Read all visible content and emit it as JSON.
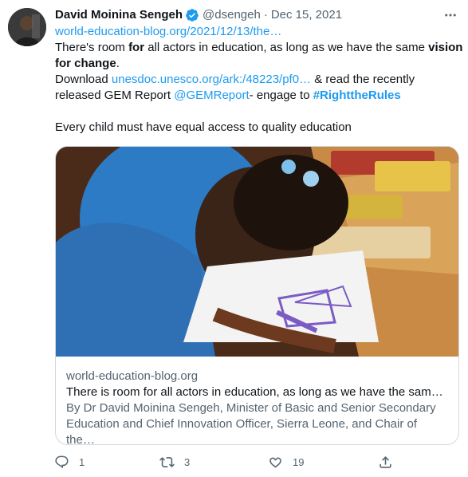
{
  "tweet": {
    "author_name": "David Moinina Sengeh",
    "handle": "@dsengeh",
    "separator": "·",
    "date": "Dec 15, 2021",
    "link1": "world-education-blog.org/2021/12/13/the…",
    "line1_a": "There's room ",
    "line1_b": "for",
    "line1_c": " all actors in education, as long as we have the same ",
    "line1_d": "vision for change",
    "line1_e": ".",
    "line2_a": "Download ",
    "line2_link": "unesdoc.unesco.org/ark:/48223/pf0…",
    "line2_b": " & read the recently released GEM Report ",
    "mention": "@GEMReport",
    "line2_c": "- engage to ",
    "hashtag": "#RighttheRules",
    "line3": "Every child must have equal access to quality education"
  },
  "card": {
    "domain": "world-education-blog.org",
    "title": "There is room for all actors in education, as long as we have the same …",
    "description": "By Dr David Moinina Sengeh, Minister of Basic and Senior Secondary Education and Chief Innovation Officer, Sierra Leone, and Chair of the…"
  },
  "actions": {
    "reply_count": "1",
    "retweet_count": "3",
    "like_count": "19"
  },
  "icons": [
    "verified-icon",
    "more-icon",
    "reply-icon",
    "retweet-icon",
    "like-icon",
    "share-icon"
  ],
  "colors": {
    "link": "#1d9bf0",
    "muted": "#536471",
    "text": "#0f1419"
  }
}
